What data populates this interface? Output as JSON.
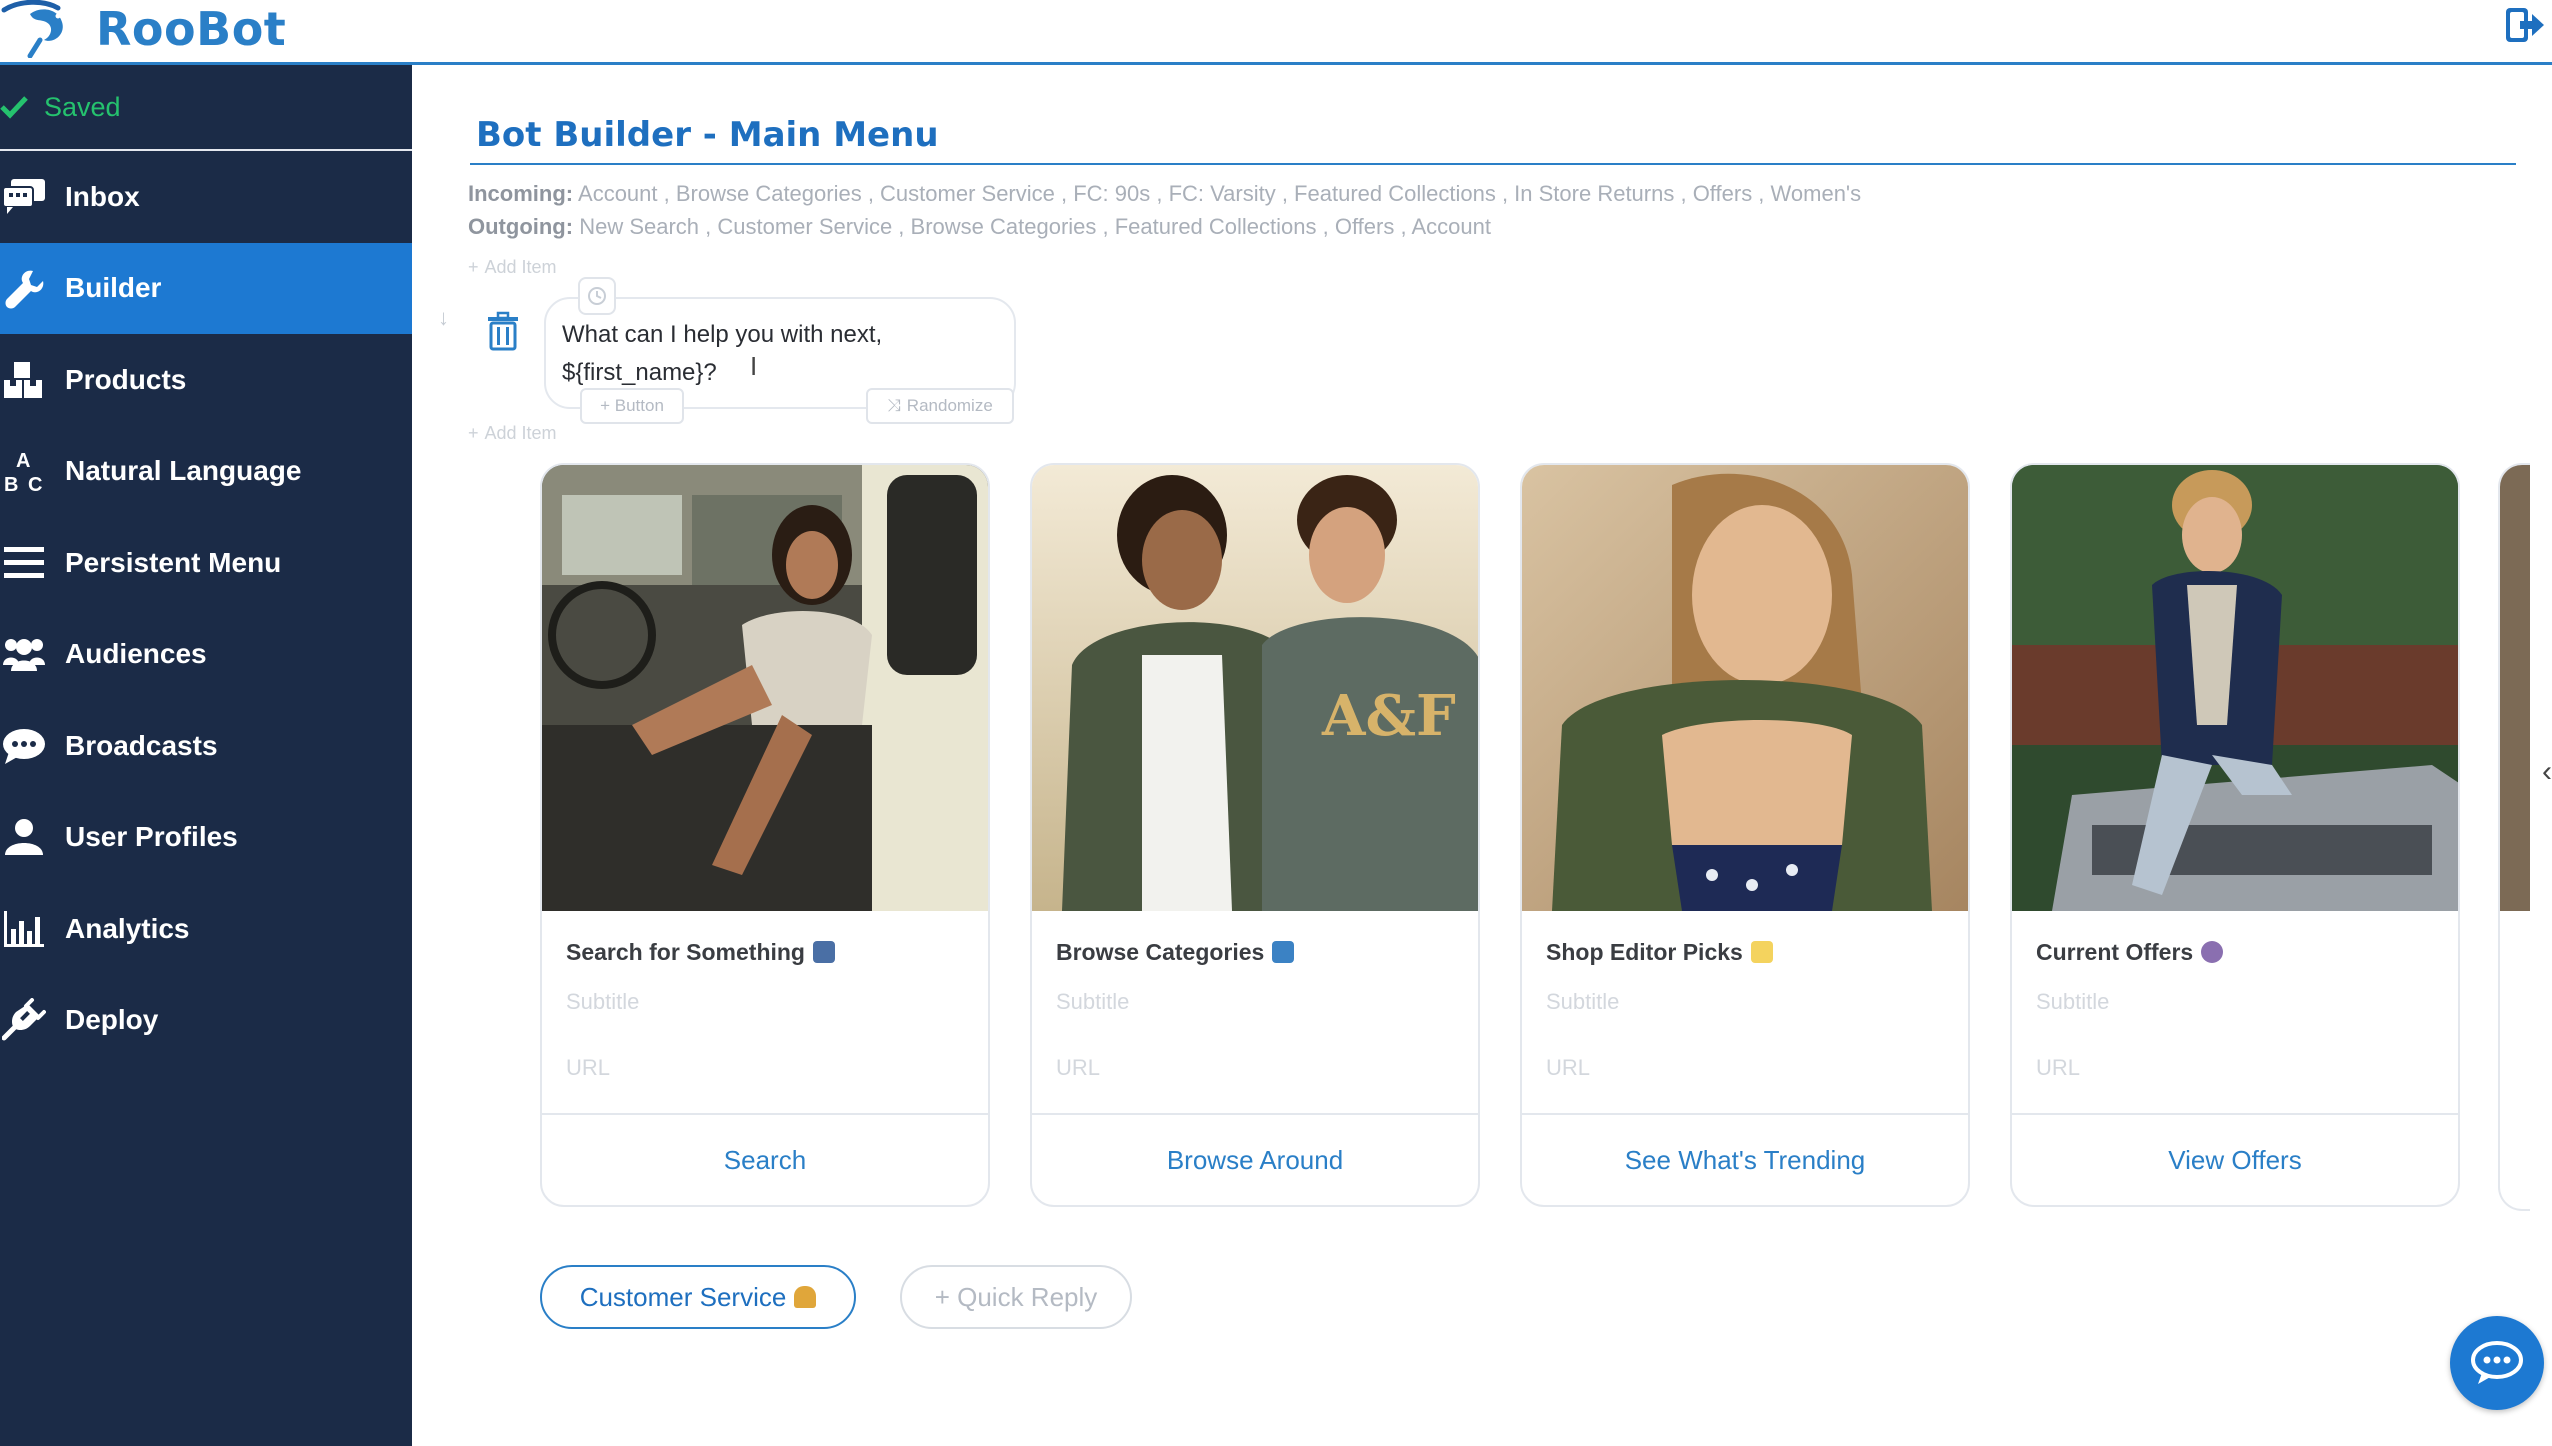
{
  "app": {
    "logo_text": "RooBot"
  },
  "sidebar": {
    "status": "Saved",
    "items": [
      {
        "label": "Inbox",
        "icon": "inbox-icon",
        "active": false
      },
      {
        "label": "Builder",
        "icon": "wrench-icon",
        "active": true
      },
      {
        "label": "Products",
        "icon": "boxes-icon",
        "active": false
      },
      {
        "label": "Natural Language",
        "icon": "abc-icon",
        "active": false
      },
      {
        "label": "Persistent Menu",
        "icon": "menu-icon",
        "active": false
      },
      {
        "label": "Audiences",
        "icon": "users-icon",
        "active": false
      },
      {
        "label": "Broadcasts",
        "icon": "chat-bubble-icon",
        "active": false
      },
      {
        "label": "User Profiles",
        "icon": "user-icon",
        "active": false
      },
      {
        "label": "Analytics",
        "icon": "bar-chart-icon",
        "active": false
      },
      {
        "label": "Deploy",
        "icon": "plug-icon",
        "active": false
      }
    ]
  },
  "main": {
    "title": "Bot Builder - Main Menu",
    "incoming_label": "Incoming:",
    "incoming": "Account , Browse Categories , Customer Service , FC: 90s , FC: Varsity , Featured Collections , In Store Returns , Offers , Women's",
    "outgoing_label": "Outgoing:",
    "outgoing": "New Search , Customer Service , Browse Categories , Featured Collections , Offers , Account",
    "add_item": "Add Item",
    "message": {
      "text": "What can I help you with next,\n${first_name}?",
      "button_label": "+ Button",
      "randomize_label": "Randomize"
    },
    "cards": [
      {
        "title": "Search for Something",
        "emoji_color": "#4a6fa5",
        "subtitle_placeholder": "Subtitle",
        "url_placeholder": "URL",
        "button": "Search"
      },
      {
        "title": "Browse Categories",
        "emoji_color": "#3b82c4",
        "subtitle_placeholder": "Subtitle",
        "url_placeholder": "URL",
        "button": "Browse Around"
      },
      {
        "title": "Shop Editor Picks",
        "emoji_color": "#f4d35e",
        "subtitle_placeholder": "Subtitle",
        "url_placeholder": "URL",
        "button": "See What's Trending"
      },
      {
        "title": "Current Offers",
        "emoji_color": "#8a6fb0",
        "subtitle_placeholder": "Subtitle",
        "url_placeholder": "URL",
        "button": "View Offers"
      }
    ],
    "quick_replies": {
      "primary": "Customer Service",
      "add": "+ Quick Reply"
    }
  },
  "colors": {
    "accent": "#2a7fc7",
    "sidebar_bg": "#1b2b47",
    "sidebar_active": "#1d79d2",
    "saved_green": "#25c26e"
  }
}
